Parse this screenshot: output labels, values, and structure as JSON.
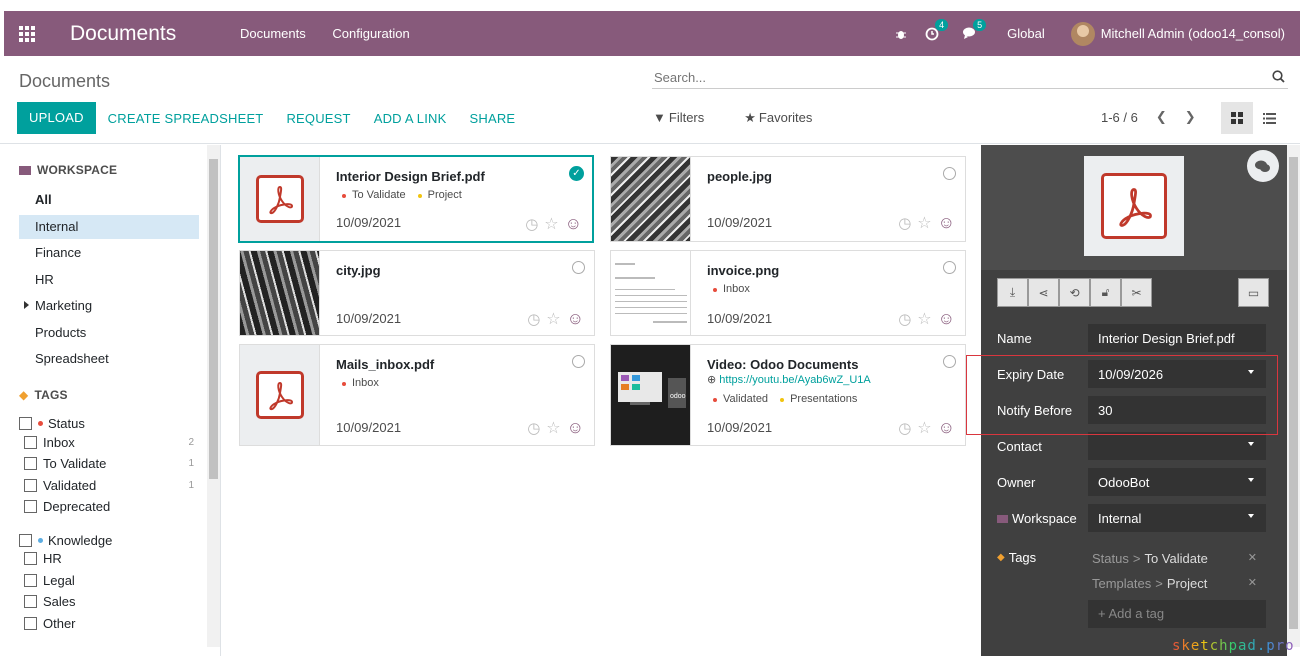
{
  "navbar": {
    "app_title": "Documents",
    "menu": [
      "Documents",
      "Configuration"
    ],
    "activity_count": "4",
    "messages_count": "5",
    "company": "Global",
    "user": "Mitchell Admin (odoo14_consol)"
  },
  "control_panel": {
    "breadcrumb": "Documents",
    "search_placeholder": "Search...",
    "buttons": {
      "upload": "UPLOAD",
      "create_spreadsheet": "CREATE SPREADSHEET",
      "request": "REQUEST",
      "add_link": "ADD A LINK",
      "share": "SHARE"
    },
    "filters_label": "Filters",
    "favorites_label": "Favorites",
    "pager": "1-6 / 6"
  },
  "sidebar": {
    "workspace_title": "WORKSPACE",
    "workspaces": [
      "All",
      "Internal",
      "Finance",
      "HR",
      "Marketing",
      "Products",
      "Spreadsheet"
    ],
    "tags_title": "TAGS",
    "status_group": "Status",
    "status_tags": [
      {
        "label": "Inbox",
        "count": "2"
      },
      {
        "label": "To Validate",
        "count": "1"
      },
      {
        "label": "Validated",
        "count": "1"
      },
      {
        "label": "Deprecated",
        "count": ""
      }
    ],
    "knowledge_group": "Knowledge",
    "knowledge_tags": [
      "HR",
      "Legal",
      "Sales",
      "Other"
    ]
  },
  "documents": [
    {
      "name": "Interior Design Brief.pdf",
      "tags": [
        "To Validate",
        "Project"
      ],
      "date": "10/09/2021"
    },
    {
      "name": "people.jpg",
      "tags": [],
      "date": "10/09/2021"
    },
    {
      "name": "city.jpg",
      "tags": [],
      "date": "10/09/2021"
    },
    {
      "name": "invoice.png",
      "tags": [
        "Inbox"
      ],
      "date": "10/09/2021"
    },
    {
      "name": "Mails_inbox.pdf",
      "tags": [
        "Inbox"
      ],
      "date": "10/09/2021"
    },
    {
      "name": "Video: Odoo Documents",
      "url": "https://youtu.be/Ayab6wZ_U1A",
      "tags": [
        "Validated",
        "Presentations"
      ],
      "date": "10/09/2021"
    }
  ],
  "details": {
    "name_label": "Name",
    "name_value": "Interior Design Brief.pdf",
    "expiry_label": "Expiry Date",
    "expiry_value": "10/09/2026",
    "notify_label": "Notify Before",
    "notify_value": "30",
    "contact_label": "Contact",
    "contact_value": "",
    "owner_label": "Owner",
    "owner_value": "OdooBot",
    "workspace_label": "Workspace",
    "workspace_value": "Internal",
    "tags_label": "Tags",
    "tags": [
      {
        "group": "Status",
        "value": "To Validate"
      },
      {
        "group": "Templates",
        "value": "Project"
      }
    ],
    "add_tag_placeholder": "+ Add a tag"
  },
  "colors": {
    "brand": "#875a7b",
    "accent": "#00a09d",
    "red_dot": "#e74c3c",
    "yellow_dot": "#f1c40f",
    "blue_dot": "#5dade2"
  },
  "watermark": "sketchpad.pro"
}
